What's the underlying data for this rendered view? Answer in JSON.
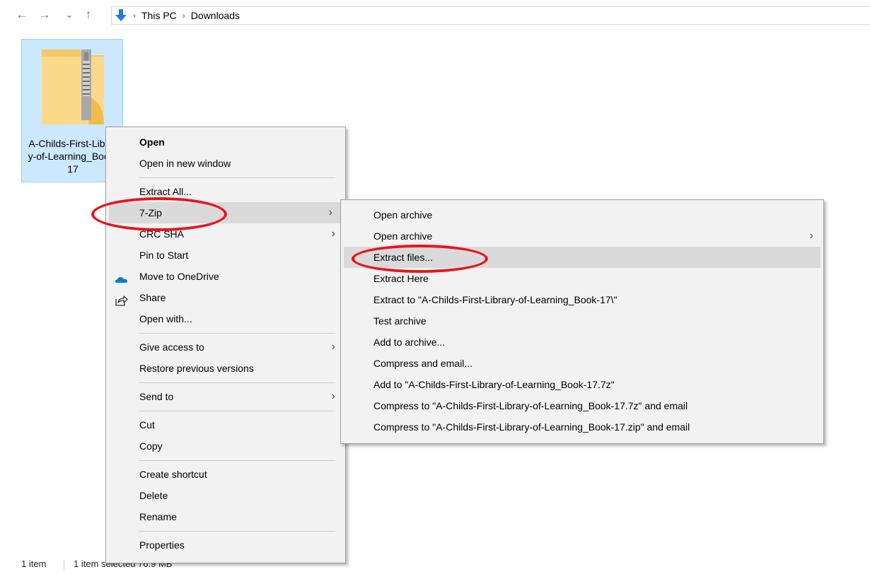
{
  "nav": {
    "back": "←",
    "forward": "→",
    "recent": "⌄",
    "up": "↑"
  },
  "address": {
    "crumbs": [
      "This PC",
      "Downloads"
    ],
    "separator": "›"
  },
  "file": {
    "name": "A-Childs-First-Library-of-Learning_Book-17",
    "icon": "zip-folder-icon"
  },
  "status": {
    "count": "1 item",
    "selected": "1 item selected  76.9 MB"
  },
  "context_menu": {
    "items": [
      {
        "label": "Open"
      },
      {
        "label": "Open in new window"
      },
      {
        "label": "Extract All..."
      },
      {
        "label": "7-Zip"
      },
      {
        "label": "CRC SHA"
      },
      {
        "label": "Pin to Start"
      },
      {
        "label": "Move to OneDrive",
        "icon": "onedrive-cloud-icon"
      },
      {
        "label": "Share",
        "icon": "share-icon"
      },
      {
        "label": "Open with..."
      },
      {
        "label": "Give access to"
      },
      {
        "label": "Restore previous versions"
      },
      {
        "label": "Send to"
      },
      {
        "label": "Cut"
      },
      {
        "label": "Copy"
      },
      {
        "label": "Create shortcut"
      },
      {
        "label": "Delete"
      },
      {
        "label": "Rename"
      },
      {
        "label": "Properties"
      }
    ],
    "submenu_arrow": "›"
  },
  "submenu_7zip": {
    "items": [
      {
        "label": "Open archive"
      },
      {
        "label": "Open archive"
      },
      {
        "label": "Extract files..."
      },
      {
        "label": "Extract Here"
      },
      {
        "label": "Extract to \"A-Childs-First-Library-of-Learning_Book-17\\\""
      },
      {
        "label": "Test archive"
      },
      {
        "label": "Add to archive..."
      },
      {
        "label": "Compress and email..."
      },
      {
        "label": "Add to \"A-Childs-First-Library-of-Learning_Book-17.7z\""
      },
      {
        "label": "Compress to \"A-Childs-First-Library-of-Learning_Book-17.7z\" and email"
      },
      {
        "label": "Compress to \"A-Childs-First-Library-of-Learning_Book-17.zip\" and email"
      }
    ]
  },
  "colors": {
    "annotation_ring": "#e8141c",
    "selection_bg": "#cce8ff",
    "menu_bg": "#f2f2f2",
    "menu_highlight": "#dadada"
  }
}
